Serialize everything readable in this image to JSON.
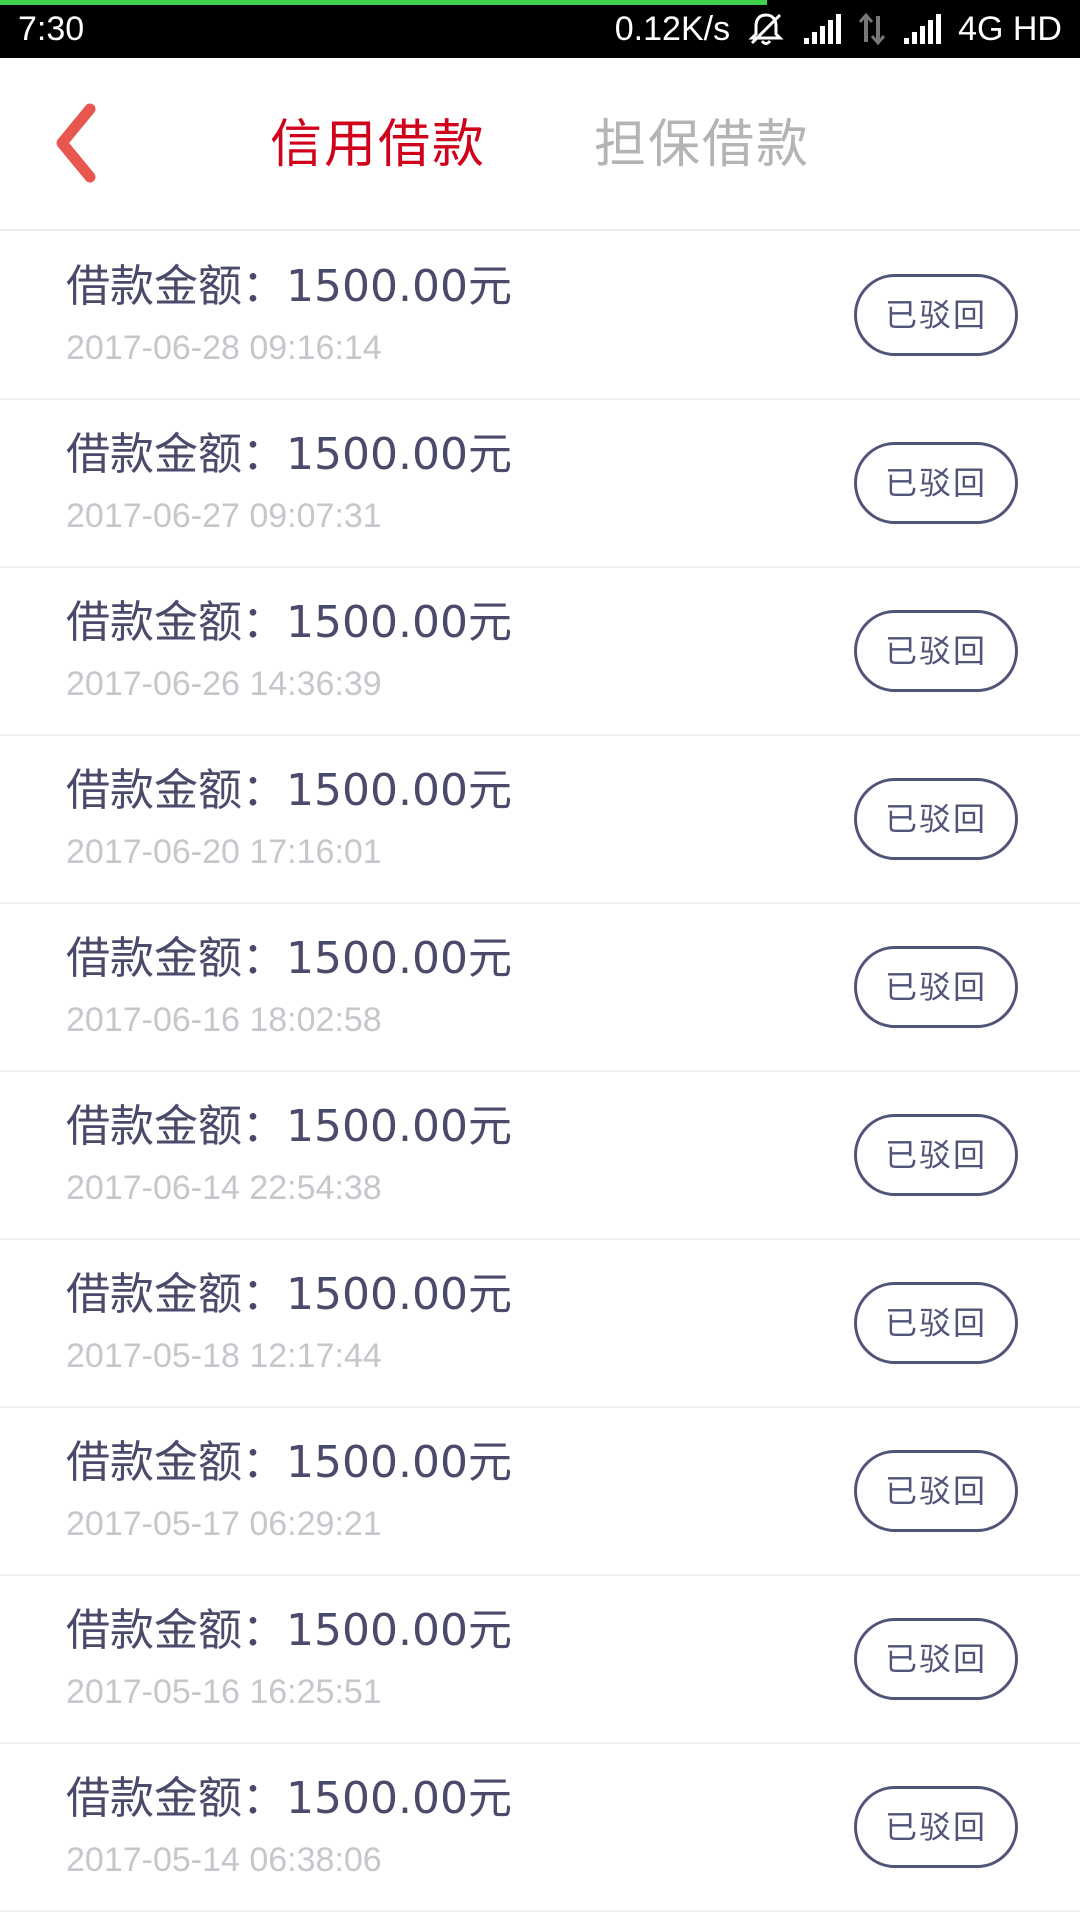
{
  "status_bar": {
    "time": "7:30",
    "network_speed": "0.12K/s",
    "network_type": "4G HD",
    "icons": [
      "notifications-off-icon",
      "signal-icon",
      "data-transfer-icon",
      "signal-icon"
    ],
    "progress": 0.71,
    "progress_color": "#3fd14b"
  },
  "nav": {
    "back_icon": "chevron-left-icon",
    "tabs": [
      {
        "label": "信用借款",
        "active": true
      },
      {
        "label": "担保借款",
        "active": false
      }
    ]
  },
  "colors": {
    "accent": "#d0021b",
    "back_icon": "#e8574d",
    "amount_text": "#4a4a6a",
    "time_text": "#c6c6cc",
    "pill_border": "#505476"
  },
  "loans": [
    {
      "amount": "借款金额：1500.00元",
      "time": "2017-06-28 09:16:14",
      "status": "已驳回"
    },
    {
      "amount": "借款金额：1500.00元",
      "time": "2017-06-27 09:07:31",
      "status": "已驳回"
    },
    {
      "amount": "借款金额：1500.00元",
      "time": "2017-06-26 14:36:39",
      "status": "已驳回"
    },
    {
      "amount": "借款金额：1500.00元",
      "time": "2017-06-20 17:16:01",
      "status": "已驳回"
    },
    {
      "amount": "借款金额：1500.00元",
      "time": "2017-06-16 18:02:58",
      "status": "已驳回"
    },
    {
      "amount": "借款金额：1500.00元",
      "time": "2017-06-14 22:54:38",
      "status": "已驳回"
    },
    {
      "amount": "借款金额：1500.00元",
      "time": "2017-05-18 12:17:44",
      "status": "已驳回"
    },
    {
      "amount": "借款金额：1500.00元",
      "time": "2017-05-17 06:29:21",
      "status": "已驳回"
    },
    {
      "amount": "借款金额：1500.00元",
      "time": "2017-05-16 16:25:51",
      "status": "已驳回"
    },
    {
      "amount": "借款金额：1500.00元",
      "time": "2017-05-14 06:38:06",
      "status": "已驳回"
    }
  ]
}
